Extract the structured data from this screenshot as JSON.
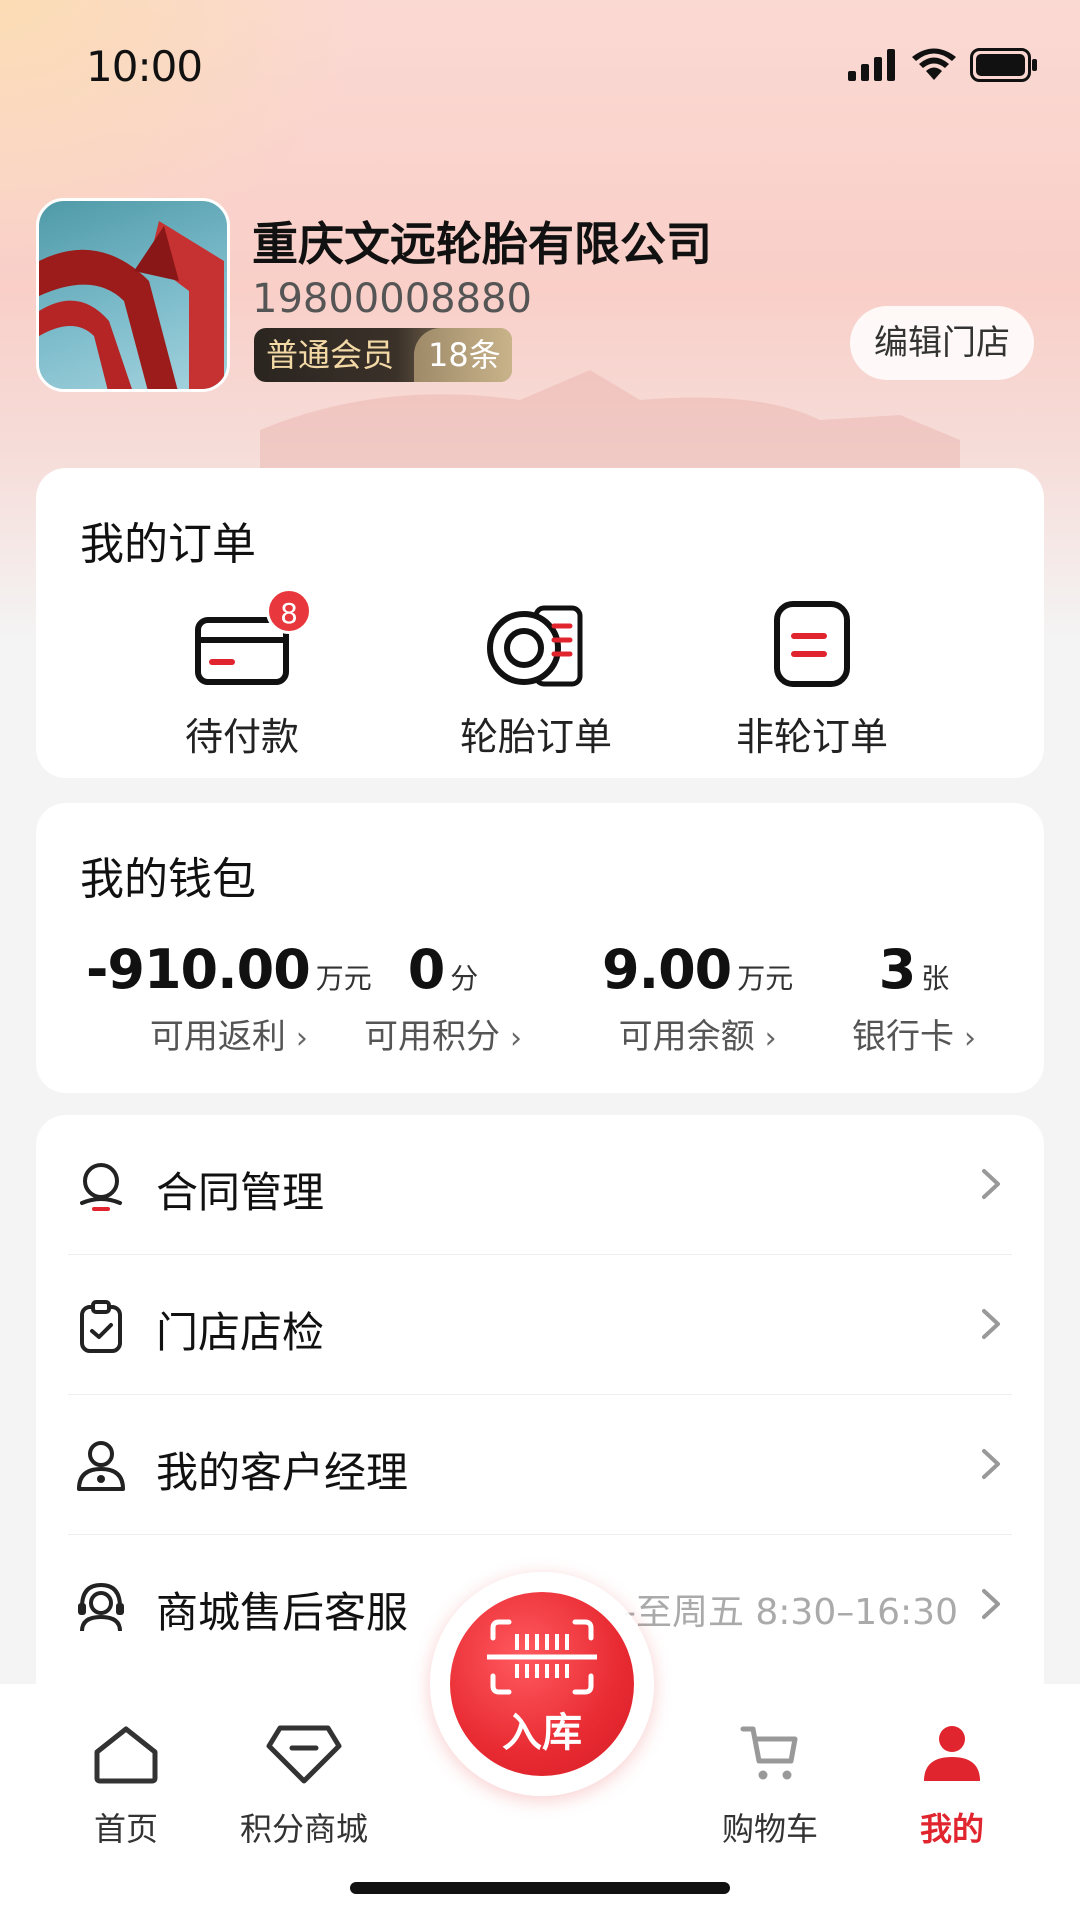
{
  "status_bar": {
    "time": "10:00"
  },
  "profile": {
    "company_name": "重庆文远轮胎有限公司",
    "phone": "19800008880",
    "member_level": "普通会员",
    "member_count": "18条",
    "edit_store_label": "编辑门店"
  },
  "orders": {
    "title": "我的订单",
    "items": [
      {
        "label": "待付款",
        "icon": "card-icon",
        "badge": "8"
      },
      {
        "label": "轮胎订单",
        "icon": "tire-icon"
      },
      {
        "label": "非轮订单",
        "icon": "document-icon"
      }
    ]
  },
  "wallet": {
    "title": "我的钱包",
    "items": [
      {
        "value": "-910.00",
        "unit": "万元",
        "label": "可用返利"
      },
      {
        "value": "0",
        "unit": "分",
        "label": "可用积分"
      },
      {
        "value": "9.00",
        "unit": "万元",
        "label": "可用余额"
      },
      {
        "value": "3",
        "unit": "张",
        "label": "银行卡"
      }
    ]
  },
  "menu": {
    "items": [
      {
        "label": "合同管理",
        "icon": "contract-icon"
      },
      {
        "label": "门店店检",
        "icon": "clipboard-check-icon"
      },
      {
        "label": "我的客户经理",
        "icon": "user-manager-icon"
      },
      {
        "label": "商城售后客服",
        "icon": "headset-icon",
        "extra": "-至周五 8:30–16:30"
      }
    ]
  },
  "tab_bar": {
    "items": [
      {
        "label": "首页",
        "icon": "home-icon"
      },
      {
        "label": "积分商城",
        "icon": "gem-icon"
      },
      {
        "label": "购物车",
        "icon": "cart-icon"
      },
      {
        "label": "我的",
        "icon": "profile-icon",
        "active": true
      }
    ],
    "center_button": {
      "label": "入库",
      "icon": "scan-barcode-icon"
    }
  },
  "colors": {
    "accent": "#e0252e",
    "badge": "#e8383d"
  }
}
